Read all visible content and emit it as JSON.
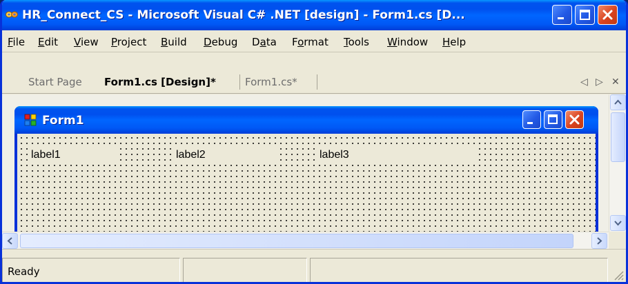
{
  "window": {
    "title": "HR_Connect_CS - Microsoft Visual C# .NET [design] - Form1.cs [D...",
    "app_icon": "visual-studio-infinity-icon"
  },
  "menu": {
    "items": [
      {
        "label": "File",
        "accel": "F"
      },
      {
        "label": "Edit",
        "accel": "E"
      },
      {
        "label": "View",
        "accel": "V"
      },
      {
        "label": "Project",
        "accel": "P"
      },
      {
        "label": "Build",
        "accel": "B"
      },
      {
        "label": "Debug",
        "accel": "D"
      },
      {
        "label": "Data",
        "accel": "a"
      },
      {
        "label": "Format",
        "accel": "o"
      },
      {
        "label": "Tools",
        "accel": "T"
      },
      {
        "label": "Window",
        "accel": "W"
      },
      {
        "label": "Help",
        "accel": "H"
      }
    ]
  },
  "tabs": {
    "items": [
      {
        "label": "Start Page",
        "active": false
      },
      {
        "label": "Form1.cs [Design]*",
        "active": true
      },
      {
        "label": "Form1.cs*",
        "active": false
      }
    ]
  },
  "form": {
    "title": "Form1",
    "labels": [
      "label1",
      "label2",
      "label3"
    ]
  },
  "status": {
    "text": "Ready"
  },
  "colors": {
    "titlebar": "#0058ee",
    "chrome": "#ece9d8",
    "close": "#d9431f"
  }
}
